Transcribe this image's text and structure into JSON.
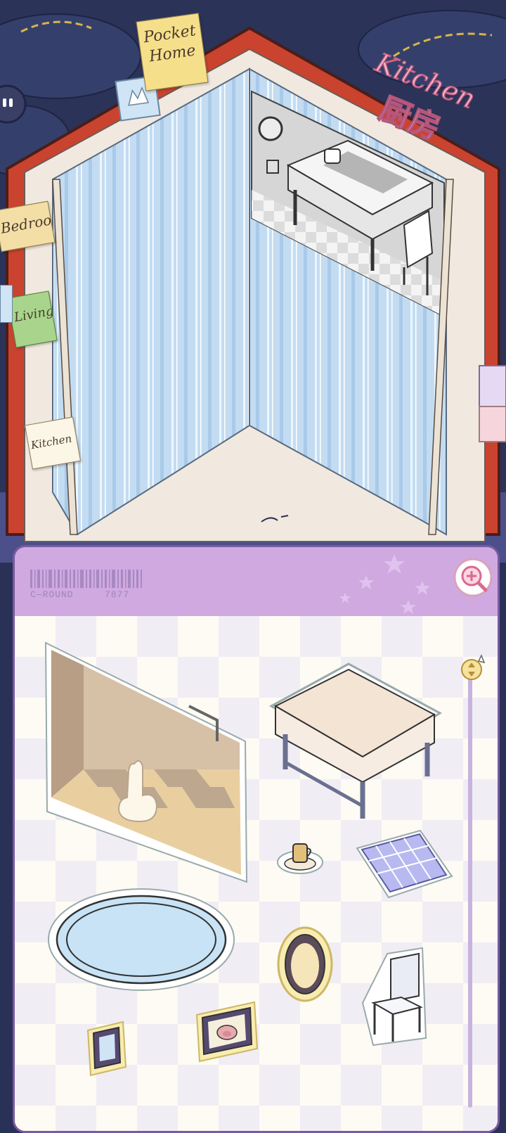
{
  "book": {
    "cover_tag": "Pocket Home",
    "room_title_en": "Kitchen",
    "room_title_cn": "厨房",
    "tabs": [
      {
        "label": "Bedroo"
      },
      {
        "label": "Living"
      },
      {
        "label": "Kitchen"
      }
    ]
  },
  "panel": {
    "round_label": "C—ROUND",
    "round_number": "7877"
  },
  "stickers": [
    {
      "name": "wall-corner-sticker"
    },
    {
      "name": "table-sticker"
    },
    {
      "name": "mug-sticker"
    },
    {
      "name": "placemat-sticker"
    },
    {
      "name": "round-rug-sticker"
    },
    {
      "name": "mirror-sticker"
    },
    {
      "name": "chair-sticker"
    },
    {
      "name": "small-frame-sticker"
    },
    {
      "name": "pig-frame-sticker"
    }
  ],
  "colors": {
    "night_sky": "#2a3157",
    "book_cover": "#c9432f",
    "wallpaper": "#bcd8f0",
    "panel_header": "#cfa9e0",
    "panel_border": "#7a5aa0",
    "tab_bedroom": "#f3dfa6",
    "tab_living": "#a8d58b",
    "tab_kitchen": "#fbf6e6"
  },
  "icons": {
    "zoom": "zoom-in-icon",
    "scroll_handle": "scroll-arrows-icon"
  }
}
